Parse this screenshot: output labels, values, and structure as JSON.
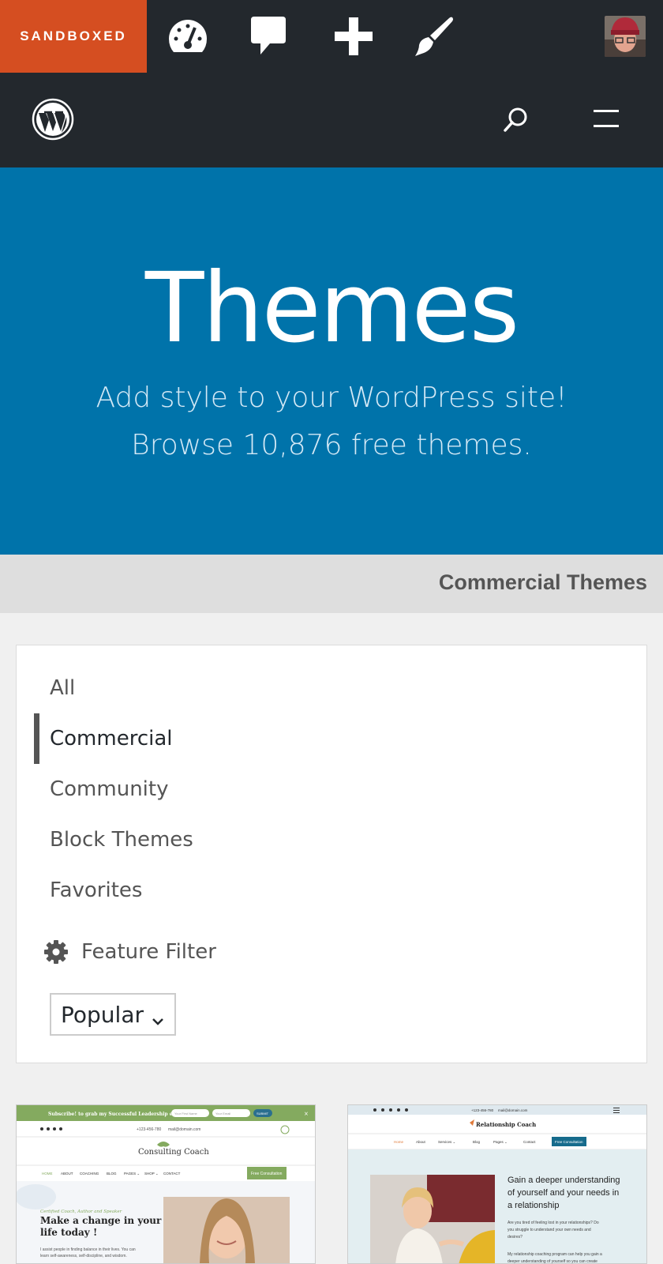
{
  "admin_bar": {
    "site_label": "SANDBOXED",
    "icons": [
      "dashboard-icon",
      "comment-icon",
      "plus-icon",
      "brush-icon"
    ]
  },
  "header": {
    "logo_icon": "wordpress-logo-icon",
    "search_icon": "search-icon",
    "menu_icon": "hamburger-menu-icon"
  },
  "hero": {
    "title": "Themes",
    "subtitle_line1": "Add style to your WordPress site!",
    "subtitle_line2": "Browse 10,876 free themes."
  },
  "section": {
    "title": "Commercial Themes"
  },
  "filters": {
    "items": [
      {
        "label": "All",
        "active": false
      },
      {
        "label": "Commercial",
        "active": true
      },
      {
        "label": "Community",
        "active": false
      },
      {
        "label": "Block Themes",
        "active": false
      },
      {
        "label": "Favorites",
        "active": false
      }
    ],
    "feature_filter_label": "Feature Filter",
    "sort_selected": "Popular"
  },
  "themes": [
    {
      "banner": "Subscribe! to grab my Successful Leadership eBook!",
      "field1": "Your First Name",
      "field2": "Your Email",
      "submit": "SUBMIT",
      "phone": "+123-456-780",
      "email": "mail@domain.com",
      "site_name": "Consulting Coach",
      "nav": [
        "HOME",
        "ABOUT",
        "COACHING",
        "BLOG",
        "PAGES ⌄",
        "SHOP ⌄",
        "CONTACT"
      ],
      "cta": "Free Consultation",
      "kicker": "Certified Coach, Author and Speaker",
      "headline": "Make a change in your life today !",
      "body": "I assist people in finding balance in their lives. You can learn self-awareness, self-discipline, and wisdom."
    },
    {
      "phone": "+123-456-780",
      "email": "mail@domain.com",
      "site_name": "Relationship Coach",
      "nav": [
        "Home",
        "About",
        "Services ⌄",
        "Blog",
        "Pages ⌄",
        "Contact"
      ],
      "cta": "Free Consultation",
      "headline": "Gain a deeper understanding of yourself and your needs in a relationship",
      "body1": "Are you tired of feeling lost in your relationships? Do you struggle to understand your own needs and desires?",
      "body2": "My relationship coaching program can help you gain a deeper understanding of yourself so you can create"
    }
  ],
  "colors": {
    "admin_bg": "#23282d",
    "sandbox": "#d54e21",
    "hero_bg": "#0073aa",
    "section_bar": "#dedede"
  }
}
